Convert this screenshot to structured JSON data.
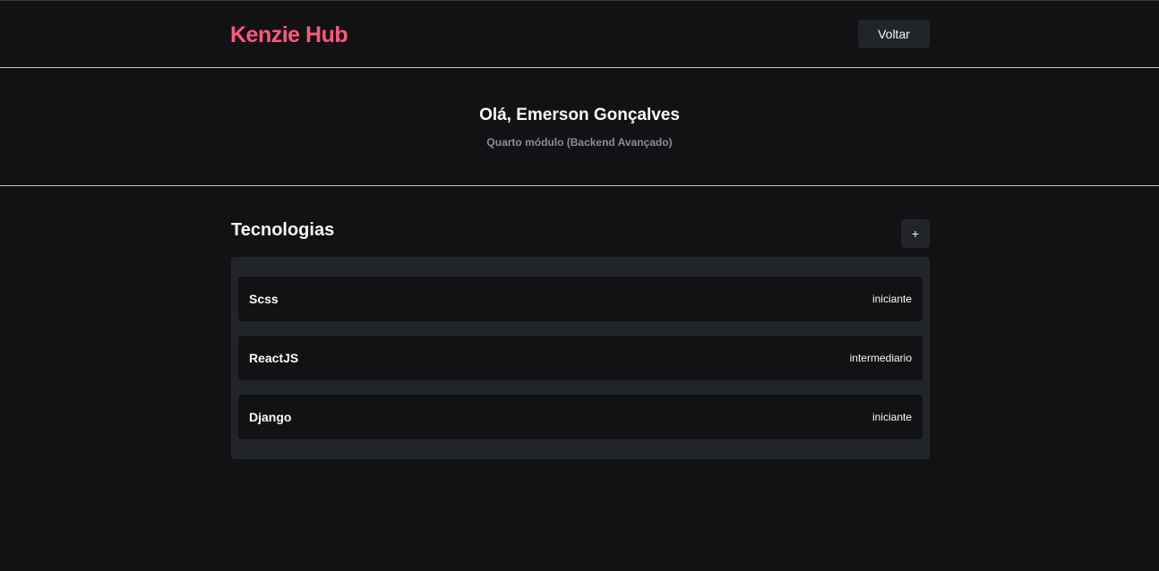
{
  "header": {
    "logo": "Kenzie Hub",
    "back_label": "Voltar"
  },
  "user": {
    "greeting": "Olá, Emerson Gonçalves",
    "module": "Quarto módulo (Backend Avançado)"
  },
  "technologies": {
    "title": "Tecnologias",
    "add_label": "+",
    "items": [
      {
        "name": "Scss",
        "status": "iniciante"
      },
      {
        "name": "ReactJS",
        "status": "intermediario"
      },
      {
        "name": "Django",
        "status": "iniciante"
      }
    ]
  },
  "colors": {
    "brand": "#FF577F",
    "background": "#121214",
    "card": "#212529",
    "text": "#F8F9FA",
    "muted": "#868E96"
  }
}
